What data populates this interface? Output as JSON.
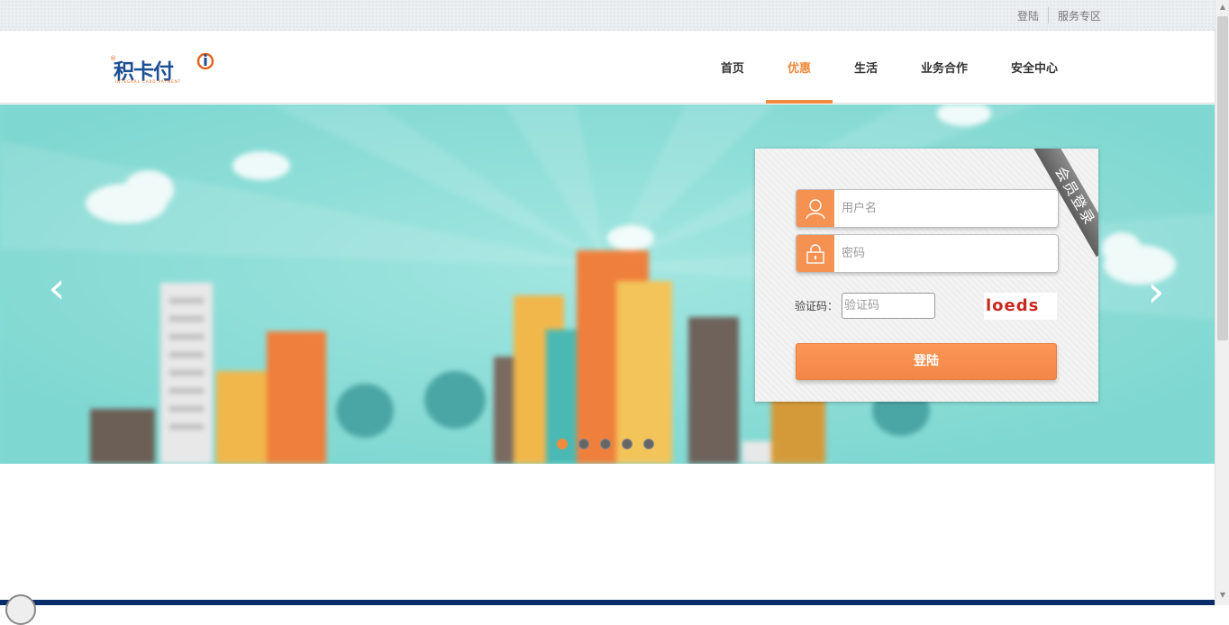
{
  "topbar": {
    "login_link": "登陆",
    "service_link": "服务专区"
  },
  "logo": {
    "brand": "积卡付",
    "sub": "INTEGRAL CARD PAYMENT",
    "reg": "®"
  },
  "nav": [
    {
      "label": "首页",
      "active": false
    },
    {
      "label": "优惠",
      "active": true
    },
    {
      "label": "生活",
      "active": false
    },
    {
      "label": "业务合作",
      "active": false
    },
    {
      "label": "安全中心",
      "active": false
    }
  ],
  "banner": {
    "prev": "‹",
    "next": "›",
    "slides": 5,
    "active_slide": 1
  },
  "login": {
    "ribbon": "会员登录",
    "username_placeholder": "用户名",
    "password_placeholder": "密码",
    "captcha_label": "验证码：",
    "captcha_placeholder": "验证码",
    "captcha_text": "loeds",
    "submit_label": "登陆"
  },
  "colors": {
    "accent": "#f08a3c",
    "banner_bg": "#84dbd5",
    "brand_blue": "#1d4f94"
  }
}
